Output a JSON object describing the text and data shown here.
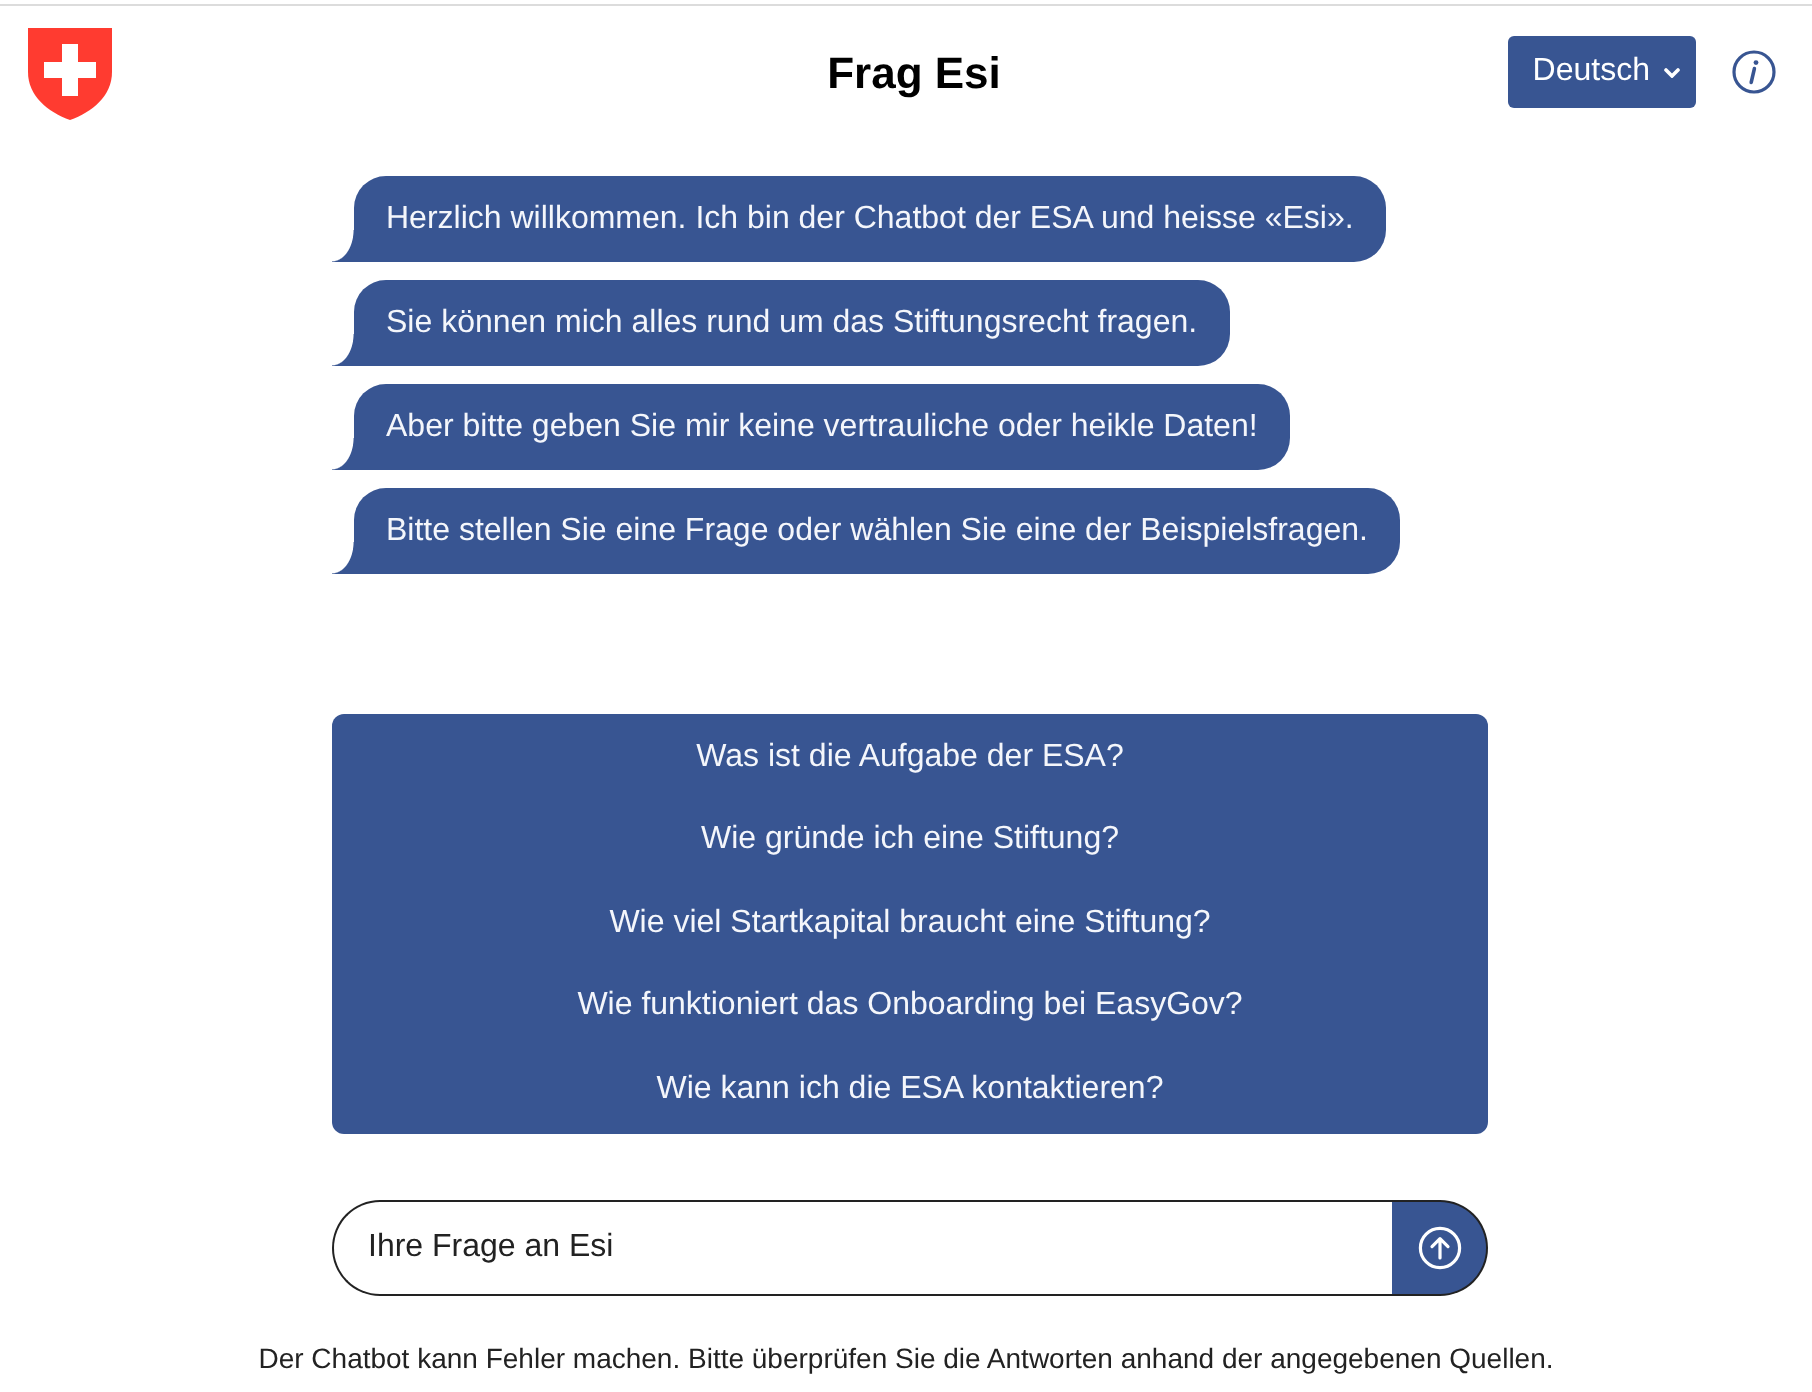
{
  "header": {
    "title": "Frag Esi",
    "language_select": {
      "value": "Deutsch"
    }
  },
  "messages": [
    {
      "text": "Herzlich willkommen. Ich bin der Chatbot der ESA und heisse «Esi»."
    },
    {
      "text": "Sie können mich alles rund um das Stiftungsrecht fragen."
    },
    {
      "text": "Aber bitte geben Sie mir keine vertrauliche oder heikle Daten!"
    },
    {
      "text": "Bitte stellen Sie eine Frage oder wählen Sie eine der Beispielsfragen."
    }
  ],
  "suggestions": [
    "Was ist die Aufgabe der ESA?",
    "Wie gründe ich eine Stiftung?",
    "Wie viel Startkapital braucht eine Stiftung?",
    "Wie funktioniert das Onboarding bei EasyGov?",
    "Wie kann ich die ESA kontaktieren?"
  ],
  "input": {
    "placeholder": "Ihre Frage an Esi"
  },
  "disclaimer": "Der Chatbot kann Fehler machen. Bitte überprüfen Sie die Antworten anhand der angegebenen Quellen."
}
